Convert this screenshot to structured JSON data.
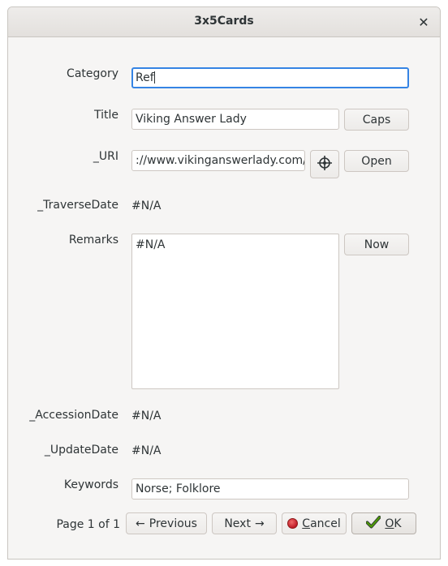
{
  "window": {
    "title": "3x5Cards"
  },
  "fields": {
    "category": {
      "label": "Category",
      "value": "Ref"
    },
    "title": {
      "label": "Title",
      "value": "Viking Answer Lady",
      "button": "Caps"
    },
    "uri": {
      "label": "_URI",
      "value": "://www.vikinganswerlady.com/",
      "button": "Open",
      "target_icon": "crosshair-icon"
    },
    "traverse_date": {
      "label": "_TraverseDate",
      "value": "#N/A"
    },
    "remarks": {
      "label": "Remarks",
      "value": "#N/A",
      "button": "Now"
    },
    "accession_date": {
      "label": "_AccessionDate",
      "value": "#N/A"
    },
    "update_date": {
      "label": "_UpdateDate",
      "value": "#N/A"
    },
    "keywords": {
      "label": "Keywords",
      "value": "Norse; Folklore"
    }
  },
  "footer": {
    "page_info": "Page 1 of 1",
    "previous": "Previous",
    "previous_arrow": "←",
    "next": "Next",
    "next_arrow": "→",
    "cancel_first": "C",
    "cancel_rest": "ancel",
    "ok_first": "O",
    "ok_rest": "K"
  },
  "colors": {
    "focus": "#3584e4",
    "cancel": "#c01c28",
    "ok_check": "#4e9a06"
  }
}
